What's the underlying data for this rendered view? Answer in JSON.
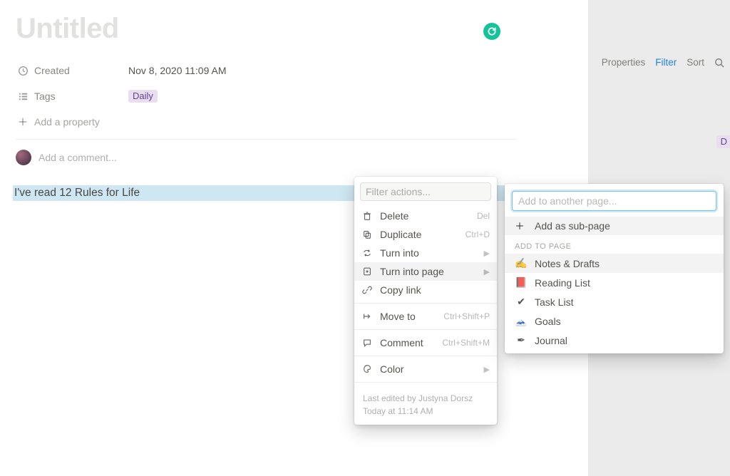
{
  "page": {
    "title": "Untitled",
    "created_label": "Created",
    "created_value": "Nov 8, 2020 11:09 AM",
    "tags_label": "Tags",
    "tag_value": "Daily",
    "add_property_label": "Add a property",
    "add_comment_placeholder": "Add a comment...",
    "body_text": "I've read 12 Rules for Life"
  },
  "toolbar_right": {
    "properties": "Properties",
    "filter": "Filter",
    "sort": "Sort"
  },
  "right_tag_preview": "D",
  "context_menu": {
    "search_placeholder": "Filter actions...",
    "delete": "Delete",
    "delete_shortcut": "Del",
    "duplicate": "Duplicate",
    "duplicate_shortcut": "Ctrl+D",
    "turn_into": "Turn into",
    "turn_into_page": "Turn into page",
    "copy_link": "Copy link",
    "move_to": "Move to",
    "move_to_shortcut": "Ctrl+Shift+P",
    "comment": "Comment",
    "comment_shortcut": "Ctrl+Shift+M",
    "color": "Color",
    "footer_line1": "Last edited by Justyna Dorsz",
    "footer_line2": "Today at 11:14 AM"
  },
  "submenu": {
    "search_placeholder": "Add to another page...",
    "add_sub_page": "Add as sub-page",
    "section_label": "ADD TO PAGE",
    "pages": [
      {
        "icon": "✍️",
        "label": "Notes & Drafts"
      },
      {
        "icon": "📕",
        "label": "Reading List"
      },
      {
        "icon": "✔",
        "label": "Task List"
      },
      {
        "icon": "🗻",
        "label": "Goals"
      },
      {
        "icon": "✒",
        "label": "Journal"
      }
    ]
  }
}
